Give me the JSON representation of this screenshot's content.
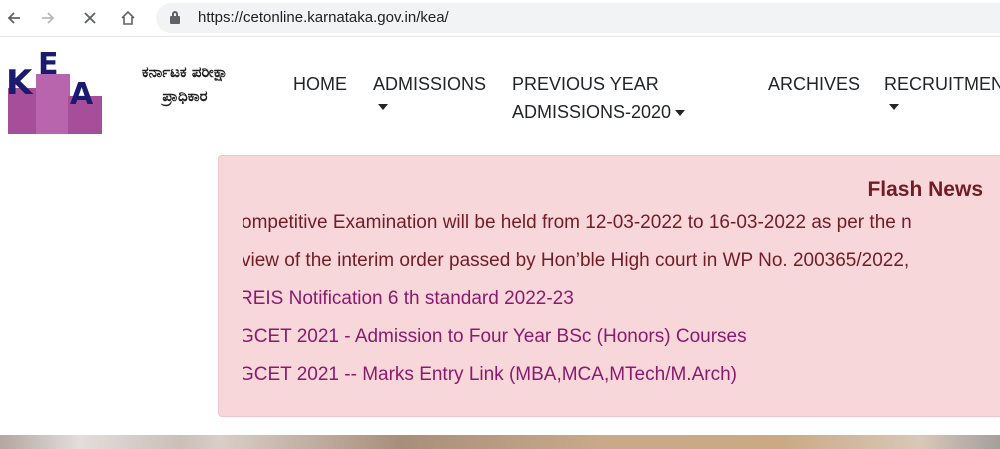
{
  "browser": {
    "url": "https://cetonline.karnataka.gov.in/kea/"
  },
  "header": {
    "logo_text": "KEA",
    "org_name_line1": "ಕರ್ನಾಟಕ ಪರೀಕ್ಷಾ",
    "org_name_line2": "ಪ್ರಾಧಿಕಾರ"
  },
  "nav": {
    "home": "HOME",
    "admissions": "ADMISSIONS",
    "previous_line1": "PREVIOUS YEAR",
    "previous_line2": "ADMISSIONS-2020",
    "archives": "ARCHIVES",
    "recruitment": "RECRUITMEN"
  },
  "flash": {
    "title": "Flash News",
    "items": [
      "ompetitive Examination will be held from 12-03-2022 to 16-03-2022 as per the n",
      "view of the interim order passed by Hon’ble High court in WP No. 200365/2022,",
      "REIS Notification 6 th standard 2022-23",
      "GCET 2021 - Admission to Four Year BSc (Honors) Courses",
      "GCET 2021 -- Marks Entry Link (MBA,MCA,MTech/M.Arch)"
    ]
  },
  "colors": {
    "logo_purple": "#a64e9a",
    "flash_bg": "#f8d7da",
    "flash_title": "#721c24",
    "news_link": "#8b1a6e"
  }
}
